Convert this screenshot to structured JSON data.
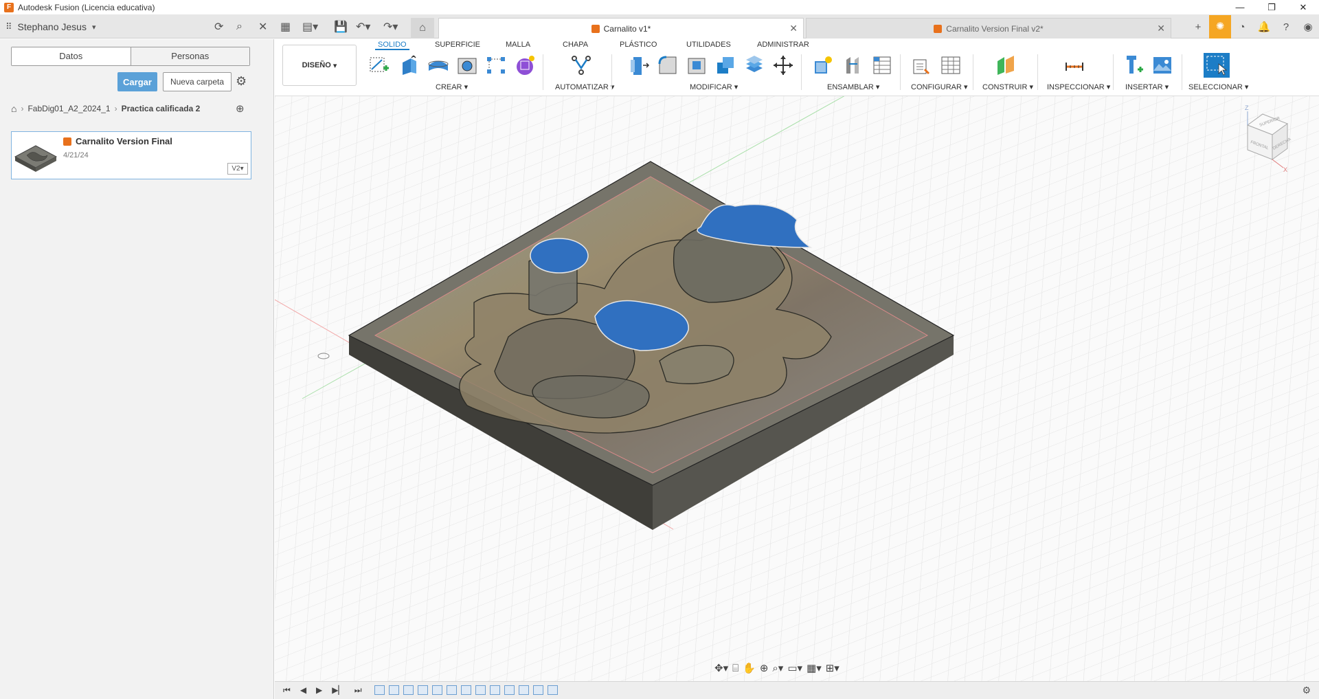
{
  "window": {
    "title": "Autodesk Fusion (Licencia educativa)",
    "controls": [
      "—",
      "❐",
      "✕"
    ]
  },
  "user": {
    "name": "Stephano Jesus"
  },
  "tabs": [
    {
      "label": "Carnalito v1*",
      "active": true
    },
    {
      "label": "Carnalito Version Final v2*",
      "active": false
    }
  ],
  "data_panel": {
    "segments": [
      "Datos",
      "Personas"
    ],
    "upload_label": "Cargar",
    "new_folder_label": "Nueva carpeta",
    "breadcrumb": [
      "FabDig01_A2_2024_1",
      "Practica calificada 2"
    ],
    "files": [
      {
        "name": "Carnalito Version Final",
        "date": "4/21/24",
        "version": "V2"
      }
    ]
  },
  "toolbar": {
    "workspace": "DISEÑO",
    "workspace_tabs": [
      "SOLIDO",
      "SUPERFICIE",
      "MALLA",
      "CHAPA",
      "PLÁSTICO",
      "UTILIDADES",
      "ADMINISTRAR"
    ],
    "groups": [
      "CREAR",
      "AUTOMATIZAR",
      "MODIFICAR",
      "ENSAMBLAR",
      "CONFIGURAR",
      "CONSTRUIR",
      "INSPECCIONAR",
      "INSERTAR",
      "SELECCIONAR"
    ]
  },
  "viewcube": {
    "top": "SUPERIOR",
    "front": "FRONTAL",
    "right": "DERECHA",
    "axis_z": "Z",
    "axis_x": "X"
  },
  "colors": {
    "accent": "#1c7dc6",
    "fusion_orange": "#e8711c",
    "primary_button": "#5ba1d8"
  }
}
